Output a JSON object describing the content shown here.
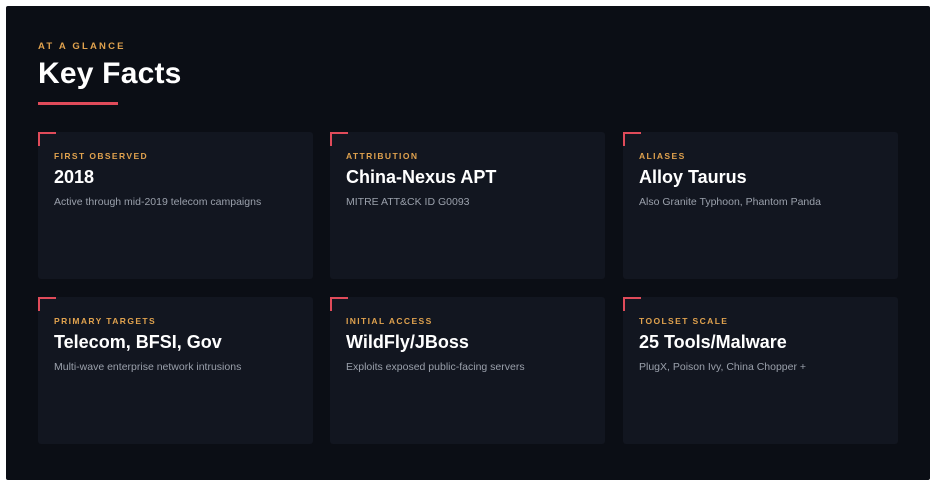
{
  "header": {
    "eyebrow": "AT A GLANCE",
    "title": "Key Facts"
  },
  "colors": {
    "background": "#0b0e15",
    "card": "#121620",
    "accent_red": "#e04b5a",
    "accent_gold": "#e0a24e",
    "text_primary": "#ffffff",
    "text_muted": "#9aa0ab"
  },
  "cards": [
    {
      "label": "FIRST OBSERVED",
      "value": "2018",
      "description": "Active through mid-2019 telecom campaigns"
    },
    {
      "label": "ATTRIBUTION",
      "value": "China-Nexus APT",
      "description": "MITRE ATT&CK ID G0093"
    },
    {
      "label": "ALIASES",
      "value": "Alloy Taurus",
      "description": "Also Granite Typhoon, Phantom Panda"
    },
    {
      "label": "PRIMARY TARGETS",
      "value": "Telecom, BFSI, Gov",
      "description": "Multi-wave enterprise network intrusions"
    },
    {
      "label": "INITIAL ACCESS",
      "value": "WildFly/JBoss",
      "description": "Exploits exposed public-facing servers"
    },
    {
      "label": "TOOLSET SCALE",
      "value": "25 Tools/Malware",
      "description": "PlugX, Poison Ivy, China Chopper +"
    }
  ]
}
